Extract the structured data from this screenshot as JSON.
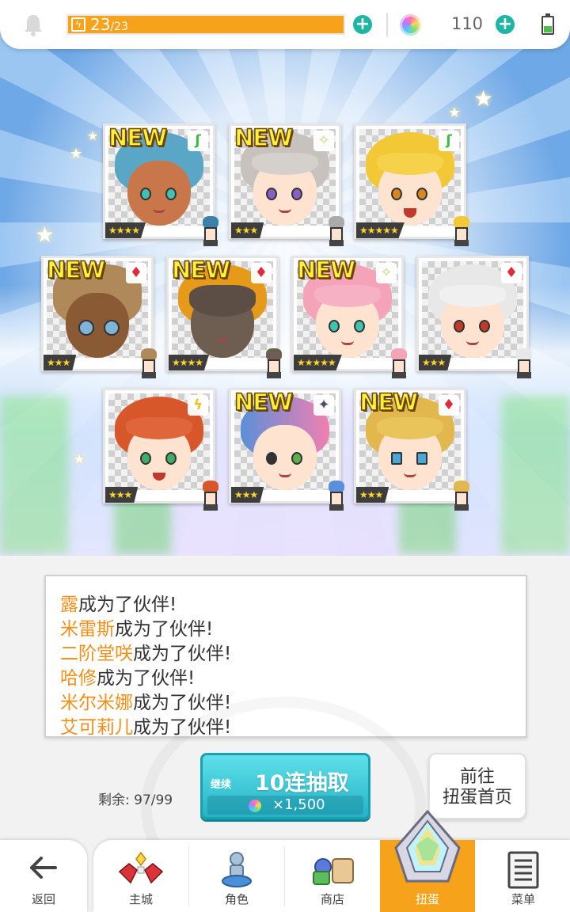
{
  "status_bar": {
    "stamina_current": "23",
    "stamina_max": "/23",
    "stamina_fraction": 1.0,
    "gem_count": "110",
    "accent": "#f7a21b",
    "plus_color": "#1fb5a3"
  },
  "cards": [
    {
      "new": "NEW",
      "stars": "★★★★",
      "element": "leaf-icon"
    },
    {
      "new": "NEW",
      "stars": "★★★",
      "element": "sparkle-icon"
    },
    {
      "new": "",
      "stars": "★★★★★",
      "element": "leaf-icon"
    },
    {
      "new": "NEW",
      "stars": "★★★",
      "element": "diamond-icon"
    },
    {
      "new": "NEW",
      "stars": "★★★★",
      "element": "diamond-icon"
    },
    {
      "new": "NEW",
      "stars": "★★★★★",
      "element": "sparkle-icon"
    },
    {
      "new": "",
      "stars": "★★★",
      "element": "diamond-icon"
    },
    {
      "new": "",
      "stars": "★★★",
      "element": "lightning-icon"
    },
    {
      "new": "NEW",
      "stars": "★★★",
      "element": "dark-star-icon"
    },
    {
      "new": "NEW",
      "stars": "★★★",
      "element": "diamond-icon"
    }
  ],
  "messages": [
    {
      "name": "露",
      "text": "成为了伙伴!"
    },
    {
      "name": "米雷斯",
      "text": "成为了伙伴!"
    },
    {
      "name": "二阶堂咲",
      "text": "成为了伙伴!"
    },
    {
      "name": "哈修",
      "text": "成为了伙伴!"
    },
    {
      "name": "米尔米娜",
      "text": "成为了伙伴!"
    },
    {
      "name": "艾可莉儿",
      "text": "成为了伙伴!"
    }
  ],
  "draw": {
    "remaining": "剩余: 97/99",
    "continue": "继续",
    "label": "10连抽取",
    "cost": "×1,500",
    "home_button": "前往\n扭蛋首页"
  },
  "nav": {
    "back": "返回",
    "items": [
      "主城",
      "角色",
      "商店",
      "扭蛋",
      "菜单"
    ],
    "active": "扭蛋"
  }
}
